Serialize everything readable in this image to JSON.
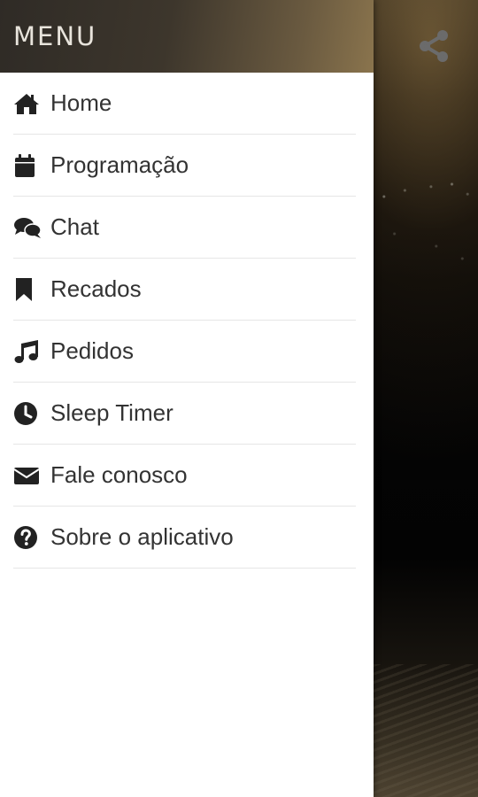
{
  "menu": {
    "title": "MENU",
    "items": [
      {
        "label": "Home",
        "icon": "home-icon"
      },
      {
        "label": "Programação",
        "icon": "calendar-icon"
      },
      {
        "label": "Chat",
        "icon": "comments-icon"
      },
      {
        "label": "Recados",
        "icon": "bookmark-icon"
      },
      {
        "label": "Pedidos",
        "icon": "music-icon"
      },
      {
        "label": "Sleep Timer",
        "icon": "clock-icon"
      },
      {
        "label": "Fale conosco",
        "icon": "envelope-icon"
      },
      {
        "label": "Sobre o aplicativo",
        "icon": "question-circle-icon"
      }
    ]
  },
  "toolbar": {
    "share_icon": "share-icon"
  },
  "colors": {
    "icon": "#222222",
    "text": "#333333",
    "divider": "#e6e6e6",
    "header_text": "#e8e4dc",
    "share_icon": "#6b6b6b"
  }
}
